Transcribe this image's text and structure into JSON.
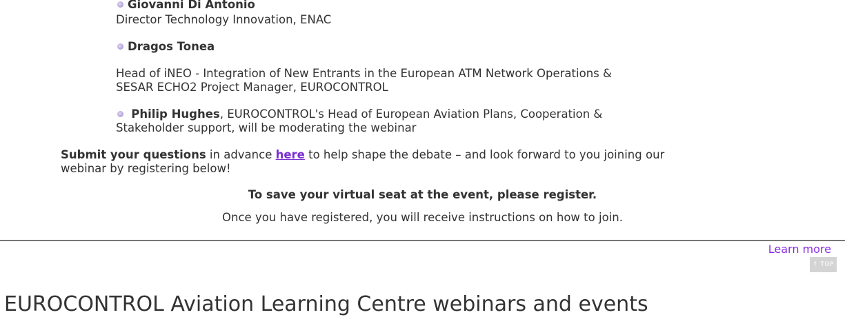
{
  "speakers": [
    {
      "name": "Giovanni Di Antonio",
      "role": "Director Technology Innovation, ENAC"
    },
    {
      "name": "Dragos Tonea",
      "role_line1": "Head of iNEO - Integration of New Entrants in the European ATM Network Operations &",
      "role_line2": "SESAR ECHO2 Project Manager, EUROCONTROL"
    },
    {
      "name": "Philip Hughes",
      "role_line1": ", EUROCONTROL's Head of European Aviation Plans, Cooperation &",
      "role_line2": "Stakeholder support, will be moderating the webinar"
    }
  ],
  "submit": {
    "bold": "Submit your questions",
    "pre_link": " in advance ",
    "link": "here",
    "post_link": " to help shape the debate – and look forward to you joining our",
    "line2": "webinar by registering below!"
  },
  "register": {
    "headline": "To save your virtual seat at the event, please register.",
    "note": "Once you have registered, you will receive instructions on how to join."
  },
  "learn_more": "Learn more",
  "top_button": "↑ TOP",
  "section_heading": "EUROCONTROL Aviation Learning Centre webinars and events"
}
